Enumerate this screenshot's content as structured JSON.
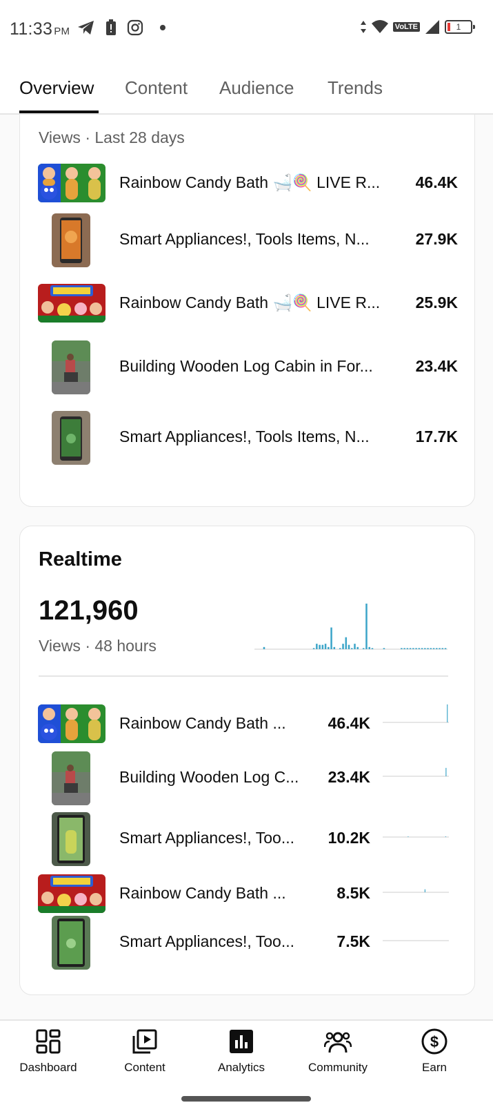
{
  "status_bar": {
    "time": "11:33",
    "ampm": "PM",
    "battery": "1"
  },
  "tabs": [
    {
      "label": "Overview",
      "active": true
    },
    {
      "label": "Content",
      "active": false
    },
    {
      "label": "Audience",
      "active": false
    },
    {
      "label": "Trends",
      "active": false
    }
  ],
  "top_content": {
    "subtitle": "Views · Last 28 days",
    "items": [
      {
        "title": "Rainbow Candy Bath 🛁🍭 LIVE R...",
        "value": "46.4K",
        "thumb": "wide"
      },
      {
        "title": "Smart Appliances!, Tools Items, N...",
        "value": "27.9K",
        "thumb": "tall"
      },
      {
        "title": "Rainbow Candy Bath 🛁🍭 LIVE R...",
        "value": "25.9K",
        "thumb": "wide"
      },
      {
        "title": "Building Wooden Log Cabin in For...",
        "value": "23.4K",
        "thumb": "tall"
      },
      {
        "title": "Smart Appliances!, Tools Items, N...",
        "value": "17.7K",
        "thumb": "tall"
      }
    ]
  },
  "realtime": {
    "title": "Realtime",
    "total": "121,960",
    "subtitle": "Views · 48 hours",
    "bars": [
      0,
      0,
      0,
      2,
      0,
      0,
      0,
      0,
      0,
      0,
      0,
      0,
      0,
      0,
      0,
      0,
      0,
      0,
      0,
      0,
      1,
      5,
      4,
      4,
      5,
      2,
      20,
      2,
      0,
      1,
      5,
      11,
      4,
      1,
      5,
      2,
      0,
      1,
      42,
      2,
      1,
      0,
      0,
      0,
      1,
      0,
      0,
      0,
      0,
      0,
      1,
      1,
      1,
      1,
      1,
      1,
      1,
      1,
      1,
      1,
      1,
      1,
      1,
      1,
      1,
      1
    ],
    "items": [
      {
        "title": "Rainbow Candy Bath ...",
        "value": "46.4K",
        "thumb": "wide",
        "spark": [
          0,
          0,
          0,
          0,
          0,
          0,
          0,
          0,
          0,
          0,
          0,
          0,
          0,
          0,
          0,
          0,
          0,
          0,
          0,
          0,
          0,
          0,
          0,
          0,
          0,
          0,
          0,
          0,
          0,
          0,
          0,
          0,
          0,
          0,
          0,
          0,
          0,
          0,
          0,
          0,
          0,
          0,
          0,
          0,
          0,
          0,
          0,
          0,
          0,
          0,
          0,
          0,
          0,
          0,
          0,
          0,
          0,
          0,
          0,
          0,
          0,
          0,
          0,
          0,
          0,
          0,
          0,
          0,
          0,
          0,
          0,
          0,
          0,
          0,
          0,
          0,
          0,
          0,
          0,
          0,
          0,
          0,
          0,
          0,
          0,
          0,
          0,
          0,
          0,
          0,
          0,
          0,
          0,
          0,
          0,
          0,
          0,
          0,
          30,
          0,
          0
        ]
      },
      {
        "title": "Building Wooden Log C...",
        "value": "23.4K",
        "thumb": "tall",
        "spark": [
          0,
          0,
          0,
          0,
          0,
          0,
          0,
          0,
          0,
          0,
          0,
          0,
          0,
          0,
          0,
          0,
          0,
          0,
          0,
          0,
          0,
          0,
          0,
          0,
          0,
          0,
          0,
          0,
          0,
          0,
          0,
          0,
          0,
          0,
          0,
          0,
          0,
          0,
          0,
          0,
          0,
          0,
          0,
          0,
          0,
          0,
          0,
          0,
          0,
          0,
          0,
          0,
          0,
          0,
          0,
          0,
          0,
          0,
          14,
          0,
          0
        ]
      },
      {
        "title": "Smart Appliances!, Too...",
        "value": "10.2K",
        "thumb": "tall",
        "spark": [
          0,
          0,
          0,
          0,
          0,
          0,
          0,
          0,
          0,
          0,
          0,
          0,
          0,
          0,
          0,
          0,
          0,
          0,
          0,
          0,
          0,
          0,
          0,
          0,
          0,
          0,
          0,
          0,
          1,
          0,
          0,
          0,
          0,
          0,
          0,
          0,
          0,
          0,
          0,
          0,
          0,
          0,
          0,
          0,
          0,
          0,
          0,
          0,
          0,
          0,
          0,
          0,
          0,
          0,
          0,
          0,
          0,
          0,
          0,
          0,
          0,
          0,
          0,
          0,
          0,
          0,
          0,
          0,
          0,
          0,
          1,
          0,
          0,
          0
        ]
      },
      {
        "title": "Rainbow Candy Bath ...",
        "value": "8.5K",
        "thumb": "wide",
        "spark": [
          0,
          0,
          0,
          0,
          0,
          0,
          0,
          0,
          0,
          0,
          0,
          0,
          0,
          0,
          0,
          0,
          0,
          0,
          0,
          0,
          0,
          0,
          0,
          0,
          0,
          0,
          0,
          0,
          0,
          0,
          0,
          0,
          0,
          0,
          0,
          0,
          0,
          0,
          5,
          0,
          0,
          0,
          0,
          0,
          0,
          0,
          0,
          0,
          0,
          0,
          0,
          0,
          0,
          0,
          0,
          0,
          0,
          0,
          0,
          0
        ]
      },
      {
        "title": "Smart Appliances!, Too...",
        "value": "7.5K",
        "thumb": "tall",
        "spark": [
          0,
          0,
          0,
          0,
          0,
          0,
          0,
          0,
          0,
          0,
          0,
          0,
          0,
          0,
          0,
          0,
          0,
          0,
          0,
          0,
          0,
          0,
          0,
          0,
          0,
          0,
          0,
          0,
          0,
          0,
          0,
          0,
          0,
          0,
          0,
          0,
          0,
          0,
          0,
          0,
          0,
          0,
          0,
          0,
          0,
          0,
          0,
          0,
          0,
          0
        ]
      }
    ]
  },
  "bottom_nav": [
    {
      "label": "Dashboard",
      "icon": "dashboard-icon",
      "active": false
    },
    {
      "label": "Content",
      "icon": "content-icon",
      "active": false
    },
    {
      "label": "Analytics",
      "icon": "analytics-icon",
      "active": true
    },
    {
      "label": "Community",
      "icon": "community-icon",
      "active": false
    },
    {
      "label": "Earn",
      "icon": "earn-icon",
      "active": false
    }
  ],
  "colors": {
    "bar": "#3ea6c9",
    "text_primary": "#0f0f0f",
    "text_secondary": "#606060"
  }
}
